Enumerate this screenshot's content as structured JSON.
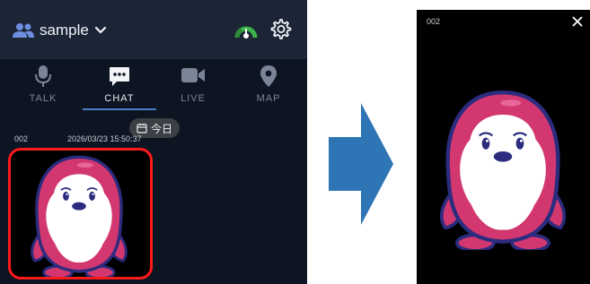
{
  "header": {
    "account_name": "sample",
    "icons": {
      "account": "users-icon",
      "dropdown": "chevron-down-icon",
      "status": "gauge-icon",
      "settings": "gear-icon"
    }
  },
  "tabs": [
    {
      "label": "TALK",
      "icon": "microphone-icon",
      "active": false
    },
    {
      "label": "CHAT",
      "icon": "chat-bubble-icon",
      "active": true
    },
    {
      "label": "LIVE",
      "icon": "video-camera-icon",
      "active": false
    },
    {
      "label": "MAP",
      "icon": "map-pin-icon",
      "active": false
    }
  ],
  "chat": {
    "date_chip": "今日",
    "message": {
      "sender": "002",
      "timestamp": "2026/03/23 15:50:37"
    }
  },
  "viewer": {
    "sender": "002",
    "close_icon": "close-icon"
  },
  "colors": {
    "accent": "#4a7fc8",
    "highlight_border": "#ff1a1a",
    "mascot_pink": "#d2386f",
    "mascot_outline": "#2b2c7e"
  }
}
